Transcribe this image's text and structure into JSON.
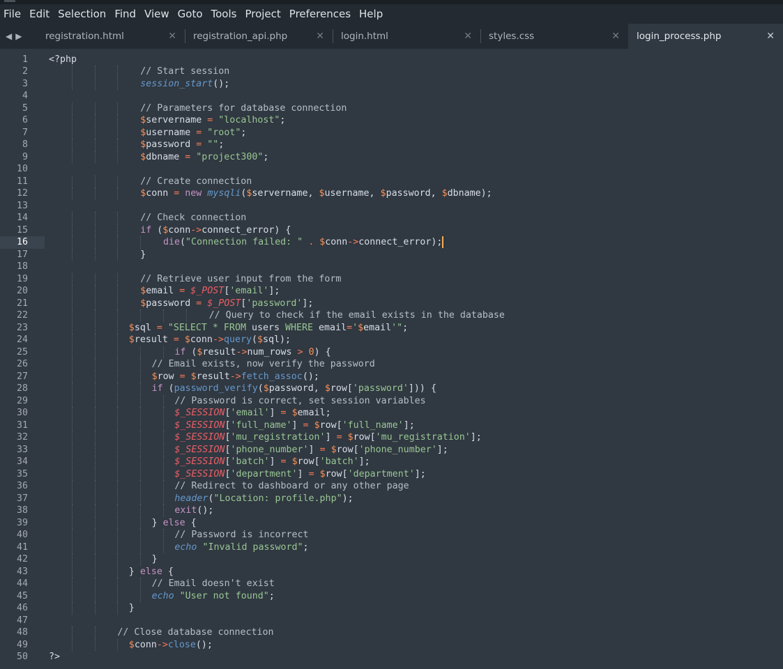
{
  "menu": [
    "File",
    "Edit",
    "Selection",
    "Find",
    "View",
    "Goto",
    "Tools",
    "Project",
    "Preferences",
    "Help"
  ],
  "tabs": [
    {
      "label": "registration.html",
      "active": false
    },
    {
      "label": "registration_api.php",
      "active": false
    },
    {
      "label": "login.html",
      "active": false
    },
    {
      "label": "styles.css",
      "active": false
    },
    {
      "label": "login_process.php",
      "active": true
    }
  ],
  "icons": {
    "back": "triangle-left-icon",
    "forward": "triangle-right-icon",
    "close": "close-x-icon"
  },
  "colors": {
    "background": "#303841",
    "menu": "#232a31",
    "comment": "#b6bec7",
    "function": "#6699cc",
    "string": "#99c794",
    "variable": "#f99157",
    "keyword": "#c594c5",
    "superglobal": "#ec5f66",
    "cursor": "#f9ae58"
  },
  "editor": {
    "active_line": 16,
    "lines": [
      {
        "n": 1,
        "tokens": [
          [
            "txt",
            "<?php"
          ]
        ]
      },
      {
        "n": 2,
        "tokens": [
          [
            "cm",
            "// Start session"
          ]
        ]
      },
      {
        "n": 3,
        "tokens": [
          [
            "fn",
            "session_start"
          ],
          [
            "txt",
            "();"
          ]
        ]
      },
      {
        "n": 4,
        "tokens": []
      },
      {
        "n": 5,
        "tokens": [
          [
            "cm",
            "// Parameters for database connection"
          ]
        ]
      },
      {
        "n": 6,
        "tokens": [
          [
            "var",
            "$"
          ],
          [
            "txt",
            "servername "
          ],
          [
            "op",
            "="
          ],
          [
            "txt",
            " "
          ],
          [
            "str",
            "\"localhost\""
          ],
          [
            "txt",
            ";"
          ]
        ]
      },
      {
        "n": 7,
        "tokens": [
          [
            "var",
            "$"
          ],
          [
            "txt",
            "username "
          ],
          [
            "op",
            "="
          ],
          [
            "txt",
            " "
          ],
          [
            "str",
            "\"root\""
          ],
          [
            "txt",
            ";"
          ]
        ]
      },
      {
        "n": 8,
        "tokens": [
          [
            "var",
            "$"
          ],
          [
            "txt",
            "password "
          ],
          [
            "op",
            "="
          ],
          [
            "txt",
            " "
          ],
          [
            "str",
            "\"\""
          ],
          [
            "txt",
            ";"
          ]
        ]
      },
      {
        "n": 9,
        "tokens": [
          [
            "var",
            "$"
          ],
          [
            "txt",
            "dbname "
          ],
          [
            "op",
            "="
          ],
          [
            "txt",
            " "
          ],
          [
            "str",
            "\"project300\""
          ],
          [
            "txt",
            ";"
          ]
        ]
      },
      {
        "n": 10,
        "tokens": []
      },
      {
        "n": 11,
        "tokens": [
          [
            "cm",
            "// Create connection"
          ]
        ]
      },
      {
        "n": 12,
        "tokens": [
          [
            "var",
            "$"
          ],
          [
            "txt",
            "conn "
          ],
          [
            "op",
            "="
          ],
          [
            "txt",
            " "
          ],
          [
            "kw",
            "new"
          ],
          [
            "txt",
            " "
          ],
          [
            "fn",
            "mysqli"
          ],
          [
            "txt",
            "("
          ],
          [
            "var",
            "$"
          ],
          [
            "txt",
            "servername, "
          ],
          [
            "var",
            "$"
          ],
          [
            "txt",
            "username, "
          ],
          [
            "var",
            "$"
          ],
          [
            "txt",
            "password, "
          ],
          [
            "var",
            "$"
          ],
          [
            "txt",
            "dbname);"
          ]
        ]
      },
      {
        "n": 13,
        "tokens": []
      },
      {
        "n": 14,
        "tokens": [
          [
            "cm",
            "// Check connection"
          ]
        ]
      },
      {
        "n": 15,
        "tokens": [
          [
            "kw",
            "if"
          ],
          [
            "txt",
            " ("
          ],
          [
            "var",
            "$"
          ],
          [
            "txt",
            "conn"
          ],
          [
            "op",
            "->"
          ],
          [
            "txt",
            "connect_error) {"
          ]
        ]
      },
      {
        "n": 16,
        "tokens": [
          [
            "kw",
            "die"
          ],
          [
            "txt",
            "("
          ],
          [
            "str",
            "\"Connection failed: \""
          ],
          [
            "txt",
            " "
          ],
          [
            "op",
            "."
          ],
          [
            "txt",
            " "
          ],
          [
            "var",
            "$"
          ],
          [
            "txt",
            "conn"
          ],
          [
            "op",
            "->"
          ],
          [
            "txt",
            "connect_error);"
          ]
        ]
      },
      {
        "n": 17,
        "tokens": [
          [
            "txt",
            "}"
          ]
        ]
      },
      {
        "n": 18,
        "tokens": []
      },
      {
        "n": 19,
        "tokens": [
          [
            "cm",
            "// Retrieve user input from the form"
          ]
        ]
      },
      {
        "n": 20,
        "tokens": [
          [
            "var",
            "$"
          ],
          [
            "txt",
            "email "
          ],
          [
            "op",
            "="
          ],
          [
            "txt",
            " "
          ],
          [
            "sg",
            "$_POST"
          ],
          [
            "txt",
            "["
          ],
          [
            "str",
            "'email'"
          ],
          [
            "txt",
            "];"
          ]
        ]
      },
      {
        "n": 21,
        "tokens": [
          [
            "var",
            "$"
          ],
          [
            "txt",
            "password "
          ],
          [
            "op",
            "="
          ],
          [
            "txt",
            " "
          ],
          [
            "sg",
            "$_POST"
          ],
          [
            "txt",
            "["
          ],
          [
            "str",
            "'password'"
          ],
          [
            "txt",
            "];"
          ]
        ]
      },
      {
        "n": 22,
        "tokens": [
          [
            "cm",
            "// Query to check if the email exists in the database"
          ]
        ]
      },
      {
        "n": 23,
        "tokens": [
          [
            "var",
            "$"
          ],
          [
            "txt",
            "sql "
          ],
          [
            "op",
            "="
          ],
          [
            "txt",
            " "
          ],
          [
            "str",
            "\"SELECT * FROM "
          ],
          [
            "txt",
            "users"
          ],
          [
            "str",
            " WHERE "
          ],
          [
            "txt",
            "email"
          ],
          [
            "op",
            "="
          ],
          [
            "str",
            "'"
          ],
          [
            "var",
            "$"
          ],
          [
            "txt",
            "email"
          ],
          [
            "str",
            "'\""
          ],
          [
            "txt",
            ";"
          ]
        ]
      },
      {
        "n": 24,
        "tokens": [
          [
            "var",
            "$"
          ],
          [
            "txt",
            "result "
          ],
          [
            "op",
            "="
          ],
          [
            "txt",
            " "
          ],
          [
            "var",
            "$"
          ],
          [
            "txt",
            "conn"
          ],
          [
            "op",
            "->"
          ],
          [
            "f2",
            "query"
          ],
          [
            "txt",
            "("
          ],
          [
            "var",
            "$"
          ],
          [
            "txt",
            "sql);"
          ]
        ]
      },
      {
        "n": 25,
        "tokens": [
          [
            "kw",
            "if"
          ],
          [
            "txt",
            " ("
          ],
          [
            "var",
            "$"
          ],
          [
            "txt",
            "result"
          ],
          [
            "op",
            "->"
          ],
          [
            "txt",
            "num_rows "
          ],
          [
            "op",
            ">"
          ],
          [
            "txt",
            " "
          ],
          [
            "n",
            "0"
          ],
          [
            "txt",
            ") {"
          ]
        ]
      },
      {
        "n": 26,
        "tokens": [
          [
            "cm",
            "// Email exists, now verify the password"
          ]
        ]
      },
      {
        "n": 27,
        "tokens": [
          [
            "var",
            "$"
          ],
          [
            "txt",
            "row "
          ],
          [
            "op",
            "="
          ],
          [
            "txt",
            " "
          ],
          [
            "var",
            "$"
          ],
          [
            "txt",
            "result"
          ],
          [
            "op",
            "->"
          ],
          [
            "f2",
            "fetch_assoc"
          ],
          [
            "txt",
            "();"
          ]
        ]
      },
      {
        "n": 28,
        "tokens": [
          [
            "kw",
            "if"
          ],
          [
            "txt",
            " ("
          ],
          [
            "f2",
            "password_verify"
          ],
          [
            "txt",
            "("
          ],
          [
            "var",
            "$"
          ],
          [
            "txt",
            "password, "
          ],
          [
            "var",
            "$"
          ],
          [
            "txt",
            "row["
          ],
          [
            "str",
            "'password'"
          ],
          [
            "txt",
            "])) {"
          ]
        ]
      },
      {
        "n": 29,
        "tokens": [
          [
            "cm",
            "// Password is correct, set session variables"
          ]
        ]
      },
      {
        "n": 30,
        "tokens": [
          [
            "sg",
            "$_SESSION"
          ],
          [
            "txt",
            "["
          ],
          [
            "str",
            "'email'"
          ],
          [
            "txt",
            "] "
          ],
          [
            "op",
            "="
          ],
          [
            "txt",
            " "
          ],
          [
            "var",
            "$"
          ],
          [
            "txt",
            "email;"
          ]
        ]
      },
      {
        "n": 31,
        "tokens": [
          [
            "sg",
            "$_SESSION"
          ],
          [
            "txt",
            "["
          ],
          [
            "str",
            "'full_name'"
          ],
          [
            "txt",
            "] "
          ],
          [
            "op",
            "="
          ],
          [
            "txt",
            " "
          ],
          [
            "var",
            "$"
          ],
          [
            "txt",
            "row["
          ],
          [
            "str",
            "'full_name'"
          ],
          [
            "txt",
            "];"
          ]
        ]
      },
      {
        "n": 32,
        "tokens": [
          [
            "sg",
            "$_SESSION"
          ],
          [
            "txt",
            "["
          ],
          [
            "str",
            "'mu_registration'"
          ],
          [
            "txt",
            "] "
          ],
          [
            "op",
            "="
          ],
          [
            "txt",
            " "
          ],
          [
            "var",
            "$"
          ],
          [
            "txt",
            "row["
          ],
          [
            "str",
            "'mu_registration'"
          ],
          [
            "txt",
            "];"
          ]
        ]
      },
      {
        "n": 33,
        "tokens": [
          [
            "sg",
            "$_SESSION"
          ],
          [
            "txt",
            "["
          ],
          [
            "str",
            "'phone_number'"
          ],
          [
            "txt",
            "] "
          ],
          [
            "op",
            "="
          ],
          [
            "txt",
            " "
          ],
          [
            "var",
            "$"
          ],
          [
            "txt",
            "row["
          ],
          [
            "str",
            "'phone_number'"
          ],
          [
            "txt",
            "];"
          ]
        ]
      },
      {
        "n": 34,
        "tokens": [
          [
            "sg",
            "$_SESSION"
          ],
          [
            "txt",
            "["
          ],
          [
            "str",
            "'batch'"
          ],
          [
            "txt",
            "] "
          ],
          [
            "op",
            "="
          ],
          [
            "txt",
            " "
          ],
          [
            "var",
            "$"
          ],
          [
            "txt",
            "row["
          ],
          [
            "str",
            "'batch'"
          ],
          [
            "txt",
            "];"
          ]
        ]
      },
      {
        "n": 35,
        "tokens": [
          [
            "sg",
            "$_SESSION"
          ],
          [
            "txt",
            "["
          ],
          [
            "str",
            "'department'"
          ],
          [
            "txt",
            "] "
          ],
          [
            "op",
            "="
          ],
          [
            "txt",
            " "
          ],
          [
            "var",
            "$"
          ],
          [
            "txt",
            "row["
          ],
          [
            "str",
            "'department'"
          ],
          [
            "txt",
            "];"
          ]
        ]
      },
      {
        "n": 36,
        "tokens": [
          [
            "cm",
            "// Redirect to dashboard or any other page"
          ]
        ]
      },
      {
        "n": 37,
        "tokens": [
          [
            "fn",
            "header"
          ],
          [
            "txt",
            "("
          ],
          [
            "str",
            "\"Location: profile.php\""
          ],
          [
            "txt",
            ");"
          ]
        ]
      },
      {
        "n": 38,
        "tokens": [
          [
            "kw",
            "exit"
          ],
          [
            "txt",
            "();"
          ]
        ]
      },
      {
        "n": 39,
        "tokens": [
          [
            "txt",
            "} "
          ],
          [
            "kw",
            "else"
          ],
          [
            "txt",
            " {"
          ]
        ]
      },
      {
        "n": 40,
        "tokens": [
          [
            "cm",
            "// Password is incorrect"
          ]
        ]
      },
      {
        "n": 41,
        "tokens": [
          [
            "fn",
            "echo"
          ],
          [
            "txt",
            " "
          ],
          [
            "str",
            "\"Invalid password\""
          ],
          [
            "txt",
            ";"
          ]
        ]
      },
      {
        "n": 42,
        "tokens": [
          [
            "txt",
            "}"
          ]
        ]
      },
      {
        "n": 43,
        "tokens": [
          [
            "txt",
            "} "
          ],
          [
            "kw",
            "else"
          ],
          [
            "txt",
            " {"
          ]
        ]
      },
      {
        "n": 44,
        "tokens": [
          [
            "cm",
            "// Email doesn't exist"
          ]
        ]
      },
      {
        "n": 45,
        "tokens": [
          [
            "fn",
            "echo"
          ],
          [
            "txt",
            " "
          ],
          [
            "str",
            "\"User not found\""
          ],
          [
            "txt",
            ";"
          ]
        ]
      },
      {
        "n": 46,
        "tokens": [
          [
            "txt",
            "}"
          ]
        ]
      },
      {
        "n": 47,
        "tokens": []
      },
      {
        "n": 48,
        "tokens": [
          [
            "cm",
            "// Close database connection"
          ]
        ]
      },
      {
        "n": 49,
        "tokens": [
          [
            "var",
            "$"
          ],
          [
            "txt",
            "conn"
          ],
          [
            "op",
            "->"
          ],
          [
            "f2",
            "close"
          ],
          [
            "txt",
            "();"
          ]
        ]
      },
      {
        "n": 50,
        "tokens": [
          [
            "txt",
            "?>"
          ]
        ]
      }
    ]
  }
}
